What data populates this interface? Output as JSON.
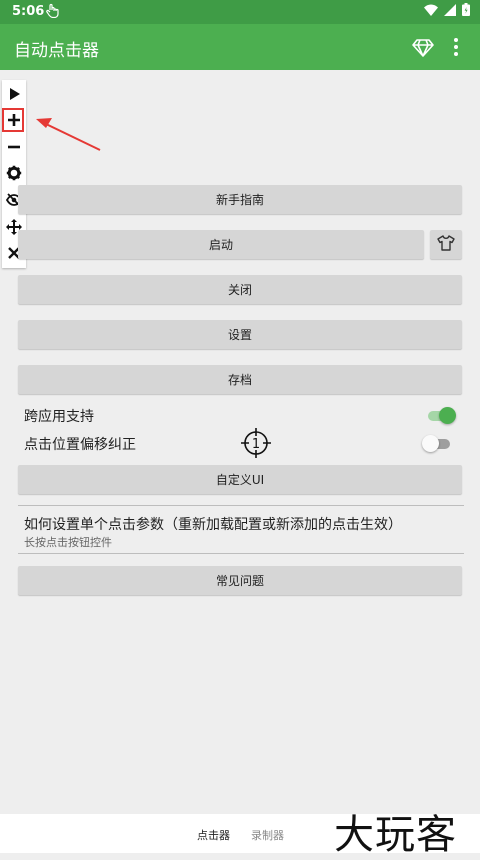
{
  "status_bar": {
    "time": "5:06"
  },
  "app_bar": {
    "title": "自动点击器"
  },
  "float_toolbar": {
    "items": [
      "play-icon",
      "plus-icon",
      "minus-icon",
      "gear-icon",
      "eye-off-icon",
      "move-icon",
      "close-icon"
    ]
  },
  "buttons": {
    "guide": "新手指南",
    "start": "启动",
    "close": "关闭",
    "settings": "设置",
    "save": "存档",
    "custom_ui": "自定义UI",
    "faq": "常见问题"
  },
  "toggles": {
    "cross_app_label": "跨应用支持",
    "cross_app_on": true,
    "offset_label": "点击位置偏移纠正",
    "offset_on": false,
    "crosshair_number": "1"
  },
  "info": {
    "title": "如何设置单个点击参数（重新加载配置或新添加的点击生效）",
    "subtitle": "长按点击按钮控件"
  },
  "bottom_tabs": {
    "active": "点击器",
    "other": "录制器"
  },
  "watermark": "大玩客",
  "colors": {
    "primary": "#4caf50",
    "status_bar": "#3f9c46",
    "highlight": "#e53935"
  }
}
